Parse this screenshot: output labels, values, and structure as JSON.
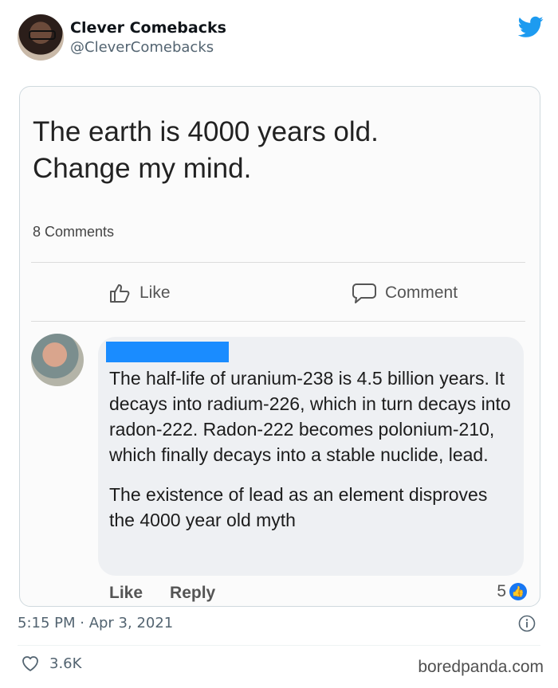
{
  "tweet": {
    "display_name": "Clever Comebacks",
    "handle": "@CleverComebacks",
    "timestamp": "5:15 PM · Apr 3, 2021",
    "likes_count": "3.6K",
    "brand_color": "#1d9bf0"
  },
  "embedded_post": {
    "post_text_line1": "The earth is 4000 years old.",
    "post_text_line2": "Change my mind.",
    "comment_count": "8 Comments",
    "like_label": "Like",
    "comment_label": "Comment",
    "comment": {
      "paragraph1": "The half-life of uranium-238 is 4.5 billion years. It decays into radium-226, which in turn decays into radon-222. Radon-222 becomes polonium-210, which finally decays into a stable nuclide, lead.",
      "paragraph2": "The existence of lead as an element disproves the 4000 year old myth",
      "like_action": "Like",
      "reply_action": "Reply",
      "reaction_count": "5",
      "redaction_color": "#1a8cff"
    }
  },
  "watermark": "boredpanda.com"
}
